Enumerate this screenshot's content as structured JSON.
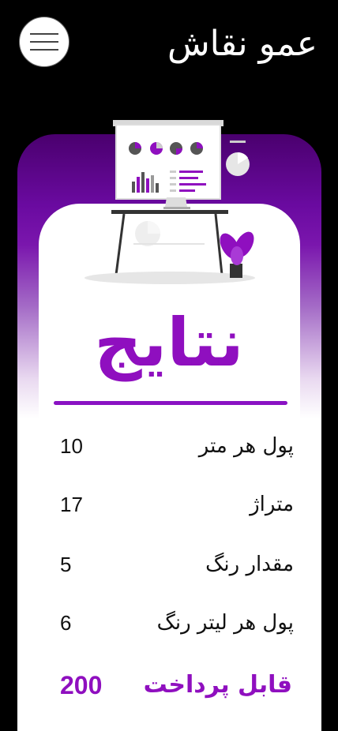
{
  "header": {
    "title": "عمو نقاش",
    "menu_icon": "hamburger-menu-icon"
  },
  "hero": {
    "illustration": "presentation-board-illustration",
    "title": "نتایج"
  },
  "results": [
    {
      "label": "پول هر متر",
      "value": "10"
    },
    {
      "label": "متراژ",
      "value": "17"
    },
    {
      "label": "مقدار رنگ",
      "value": "5"
    },
    {
      "label": "پول هر لیتر رنگ",
      "value": "6"
    }
  ],
  "total": {
    "label": "قابل پرداخت",
    "value": "200"
  },
  "colors": {
    "accent": "#8f0fbf",
    "header_bg": "#000000",
    "card_gradient_top": "#4a006e"
  }
}
